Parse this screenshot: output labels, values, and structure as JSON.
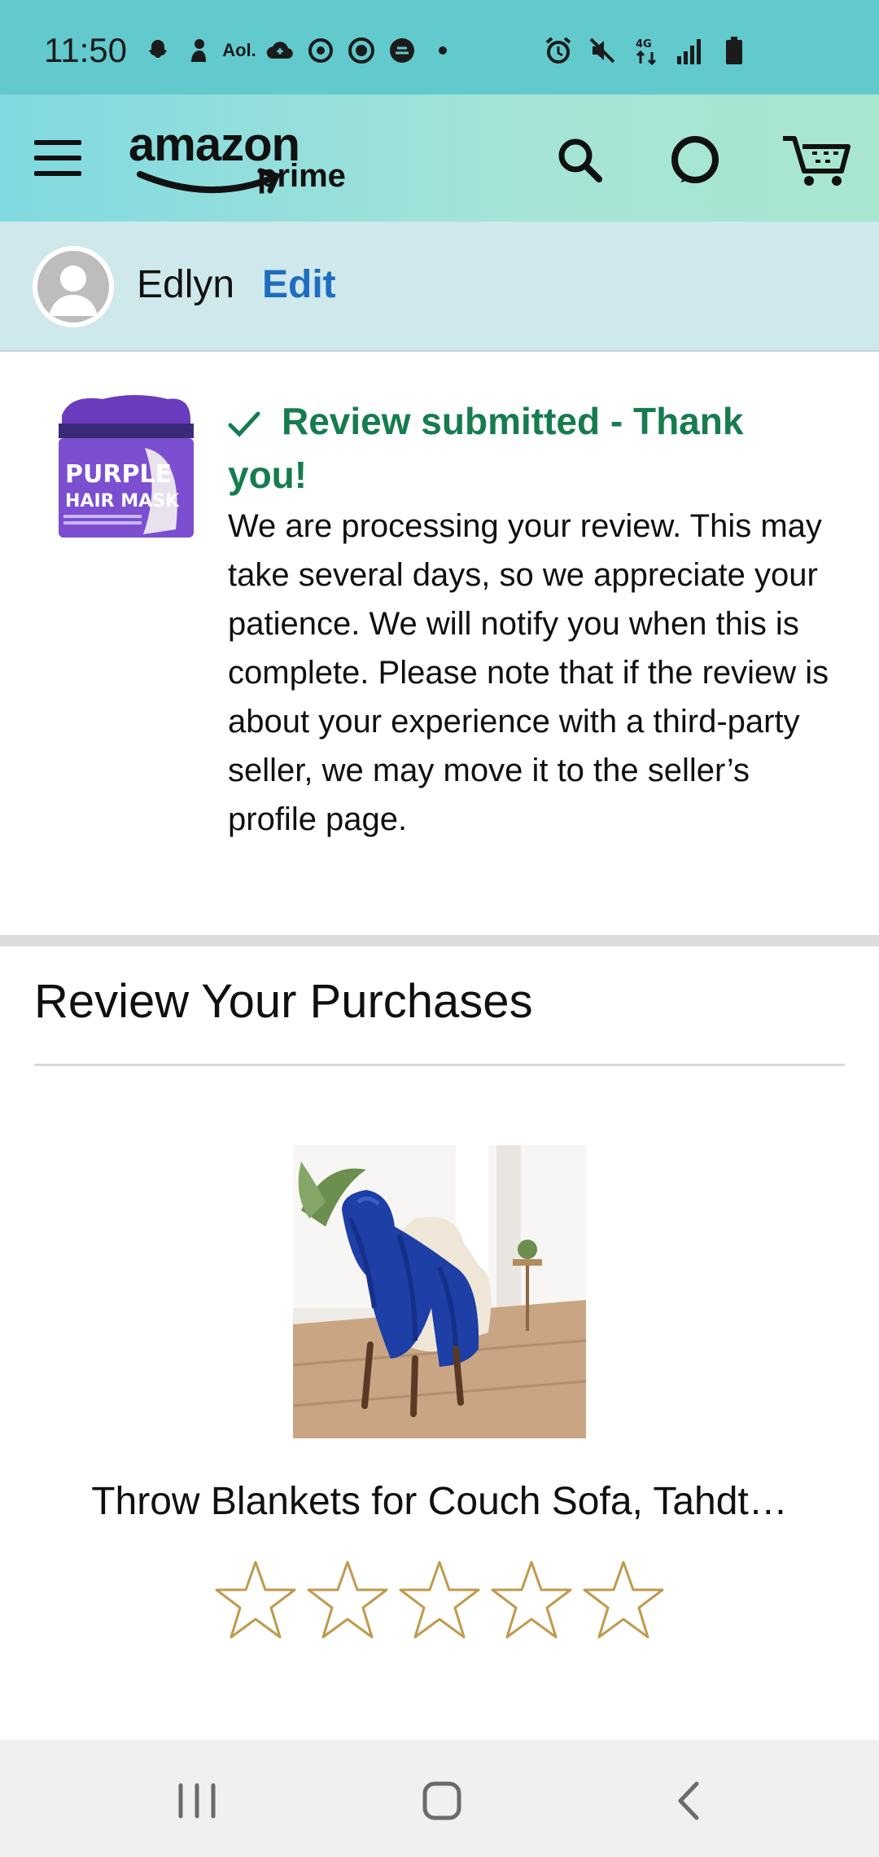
{
  "status_bar": {
    "time": "11:50",
    "left_icons": [
      "snapchat-icon",
      "person-icon",
      "aol-icon",
      "cloud-icon",
      "sync-icon",
      "record-icon",
      "shell-icon",
      "dot-icon"
    ],
    "aol_text": "Aol.",
    "right_icons": [
      "alarm-icon",
      "mute-icon",
      "lte-icon",
      "signal-icon",
      "battery-icon"
    ]
  },
  "header": {
    "logo_amazon": "amazon",
    "logo_prime": "prime",
    "icons": [
      "menu-icon",
      "search-icon",
      "alexa-icon",
      "cart-icon"
    ]
  },
  "profile": {
    "name": "Edlyn",
    "edit_label": "Edit"
  },
  "confirmation": {
    "title": "Review submitted - Thank you!",
    "body": "We are processing your review. This may take several days, so we appreciate your patience. We will notify you when this is complete. Please note that if the review is about your experience with a third-party seller, we may move it to the seller’s profile page.",
    "thumbnail": {
      "line1": "PURPLE",
      "line2": "HAIR MASK"
    }
  },
  "review_section": {
    "title": "Review Your Purchases",
    "product_title": "Throw Blankets for Couch Sofa, Tahdt…",
    "rating": 0,
    "max_rating": 5
  },
  "colors": {
    "status_bar": "#62c9cd",
    "confirm_green": "#167c4e",
    "edit_blue": "#1f6dbe",
    "star_outline": "#c09a4e"
  }
}
